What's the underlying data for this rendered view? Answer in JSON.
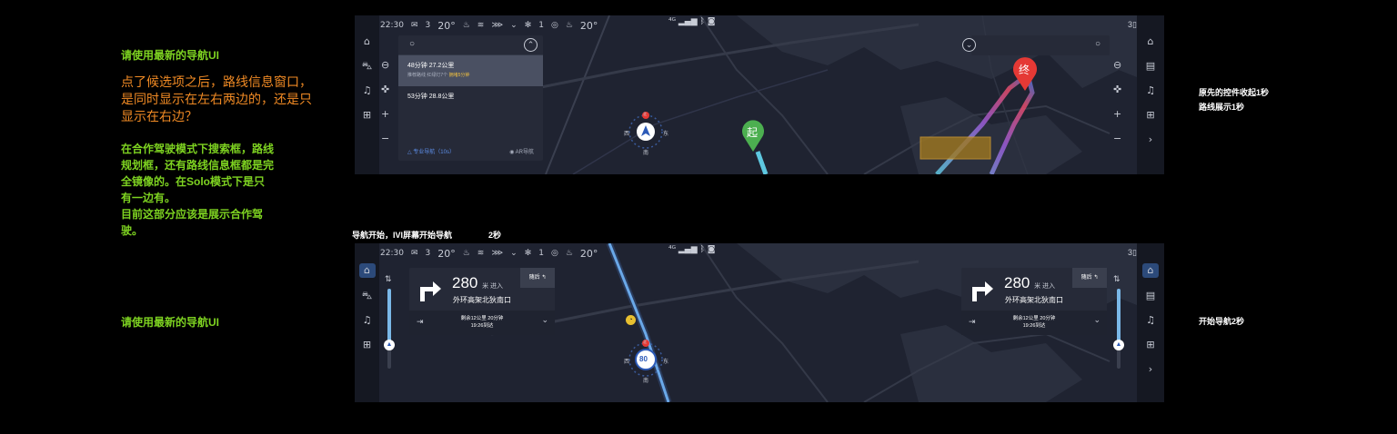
{
  "annotations": {
    "left_top_green": "请使用最新的导航UI",
    "left_orange": "点了候选项之后，路线信息窗口，\n是同时显示在左右两边的，还是只\n显示在右边？",
    "left_green_block": "在合作驾驶模式下搜索框，路线\n规划框，还有路线信息框都是完\n全镜像的。在Solo模式下是只\n有一边有。\n目前这部分应该是展示合作驾\n驶。",
    "left_bottom_green": "请使用最新的导航UI",
    "section_title": "导航开始，IVI屏幕开始导航",
    "section_time": "2秒",
    "right_top_1": "原先的控件收起1秒",
    "right_top_2": "路线展示1秒",
    "right_bottom": "开始导航2秒"
  },
  "colors": {
    "accent_green": "#7ed321",
    "accent_orange": "#f08a24",
    "route_blue": "#5d8ee8",
    "start_marker": "#4caf50",
    "end_marker": "#e53935"
  },
  "status_bar": {
    "time": "22:30",
    "mail_count": "3",
    "temp_left": "20°",
    "fan_level": "1",
    "temp_right": "20°",
    "page_indicator": "3"
  },
  "top_screen": {
    "routes": [
      {
        "main": "48分钟 27.2公里",
        "sub_prefix": "推荐路线 红绿灯7个 ",
        "sub_em": "拥堵5分钟"
      },
      {
        "main": "53分钟 28.8公里",
        "sub_prefix": "",
        "sub_em": ""
      }
    ],
    "pro_nav": "专业导航（10s）",
    "ar_nav": "AR导航",
    "start_label": "起",
    "end_label": "终",
    "compass_s": "南",
    "compass_w": "西",
    "compass_e": "东",
    "compass_n": "北"
  },
  "bottom_screen": {
    "distance": "280",
    "unit": "米 进入",
    "road": "外环高架北狄南口",
    "then_label": "随后",
    "remain": "剩余12公里 20分钟",
    "arrive": "19:26到达",
    "speed": "80",
    "compass_s": "南",
    "compass_w": "西",
    "compass_e": "东",
    "compass_n": "北"
  }
}
